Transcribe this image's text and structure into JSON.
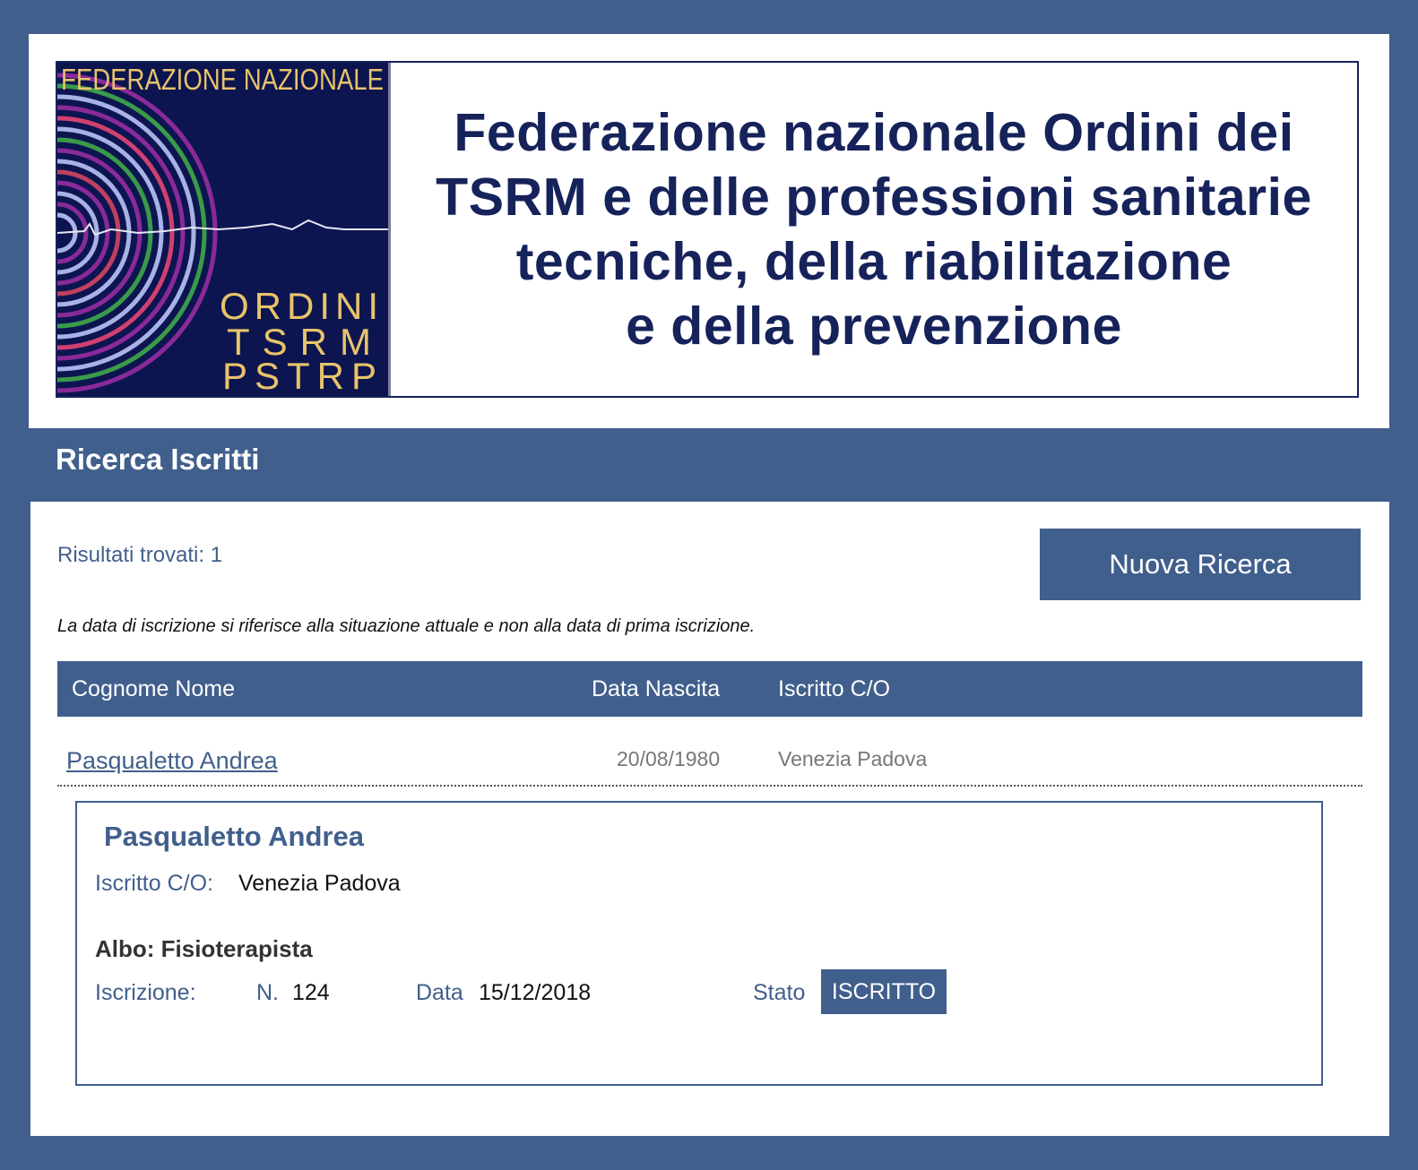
{
  "banner": {
    "logo": {
      "arc_text": "FEDERAZIONE NAZIONALE",
      "lines": [
        "ORDINI",
        "TSRM",
        "PSTRP"
      ]
    },
    "title_lines": [
      "Federazione nazionale Ordini dei",
      "TSRM e delle professioni sanitarie",
      "tecniche, della riabilitazione",
      "e della prevenzione"
    ]
  },
  "page": {
    "section_title": "Ricerca Iscritti"
  },
  "results": {
    "count_text": "Risultati trovati: 1",
    "new_search_label": "Nuova Ricerca",
    "note": "La data di iscrizione si riferisce alla situazione attuale e non alla data di prima iscrizione."
  },
  "table": {
    "headers": [
      "Cognome Nome",
      "Data Nascita",
      "Iscritto C/O"
    ],
    "rows": [
      {
        "name": "Pasqualetto Andrea",
        "birth_date": "20/08/1980",
        "registered_at": "Venezia Padova"
      }
    ]
  },
  "detail": {
    "name": "Pasqualetto Andrea",
    "iscritto_label": "Iscritto C/O:",
    "iscritto_value": "Venezia Padova",
    "albo": "Albo: Fisioterapista",
    "iscrizione_label": "Iscrizione:",
    "n_label": "N.",
    "n_value": "124",
    "data_label": "Data",
    "data_value": "15/12/2018",
    "stato_label": "Stato",
    "stato_value": "ISCRITTO"
  },
  "colors": {
    "brand_blue": "#415f8c",
    "banner_navy": "#16225a",
    "logo_bg": "#0d1550",
    "logo_text": "#e8c36a"
  }
}
